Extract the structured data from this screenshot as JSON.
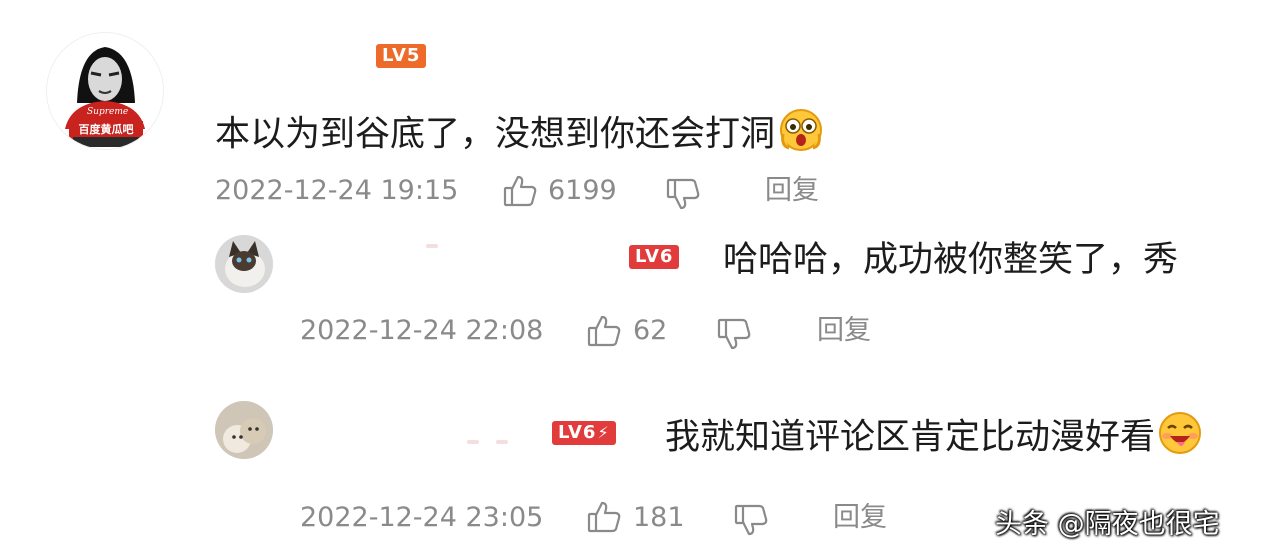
{
  "comments": [
    {
      "level": "LV5",
      "text": "本以为到谷底了，没想到你还会打洞",
      "emoji": "scared-face-emoji",
      "timestamp": "2022-12-24 19:15",
      "likes": "6199",
      "reply_label": "回复",
      "avatar_text": "百度黄瓜吧"
    },
    {
      "level": "LV6",
      "text": "哈哈哈，成功被你整笑了，秀",
      "timestamp": "2022-12-24 22:08",
      "likes": "62",
      "reply_label": "回复"
    },
    {
      "level": "LV6",
      "text": "我就知道评论区肯定比动漫好看",
      "emoji": "drooling-face-emoji",
      "timestamp": "2022-12-24 23:05",
      "likes": "181",
      "reply_label": "回复"
    }
  ],
  "colors": {
    "lv5_badge": "#ee6a2a",
    "lv6_badge": "#e23b3b",
    "meta_gray": "#8a8a8a",
    "text": "#1c1c1c"
  },
  "watermark": "头条 @隔夜也很宅"
}
